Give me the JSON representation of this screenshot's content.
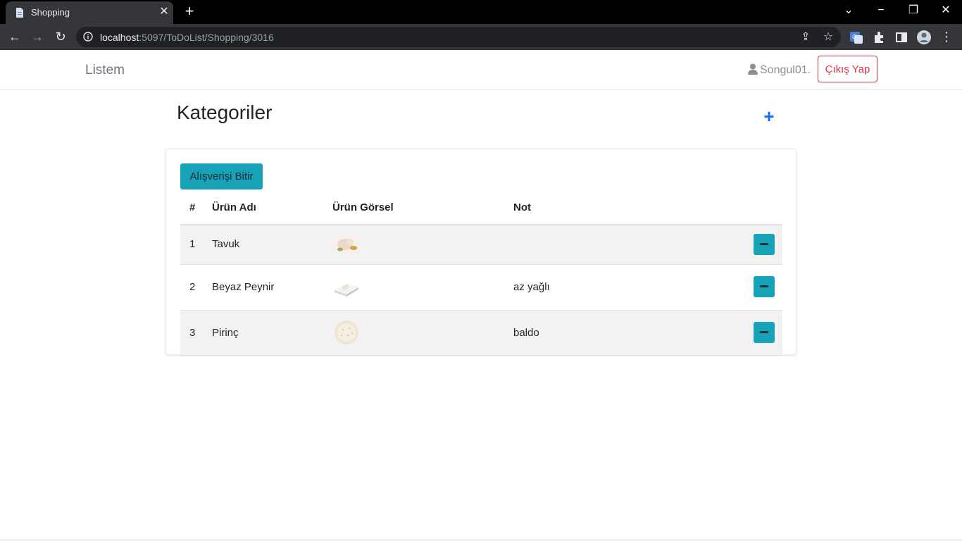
{
  "browser": {
    "tab_title": "Shopping",
    "url_host": "localhost",
    "url_path": ":5097/ToDoList/Shopping/3016"
  },
  "navbar": {
    "brand": "Listem",
    "username": "Songul01.",
    "logout_label": "Çıkış Yap"
  },
  "page": {
    "title": "Kategoriler",
    "add_label": "+",
    "finish_button": "Alışverişi Bitir"
  },
  "table": {
    "headers": [
      "#",
      "Ürün Adı",
      "Ürün Görsel",
      "Not"
    ],
    "rows": [
      {
        "index": "1",
        "name": "Tavuk",
        "image": "chicken-image",
        "note": ""
      },
      {
        "index": "2",
        "name": "Beyaz Peynir",
        "image": "white-cheese-image",
        "note": "az yağlı"
      },
      {
        "index": "3",
        "name": "Pirinç",
        "image": "rice-image",
        "note": "baldo"
      }
    ]
  },
  "colors": {
    "primary": "#0d6efd",
    "info": "#17a2b8",
    "danger": "#dc3545"
  }
}
